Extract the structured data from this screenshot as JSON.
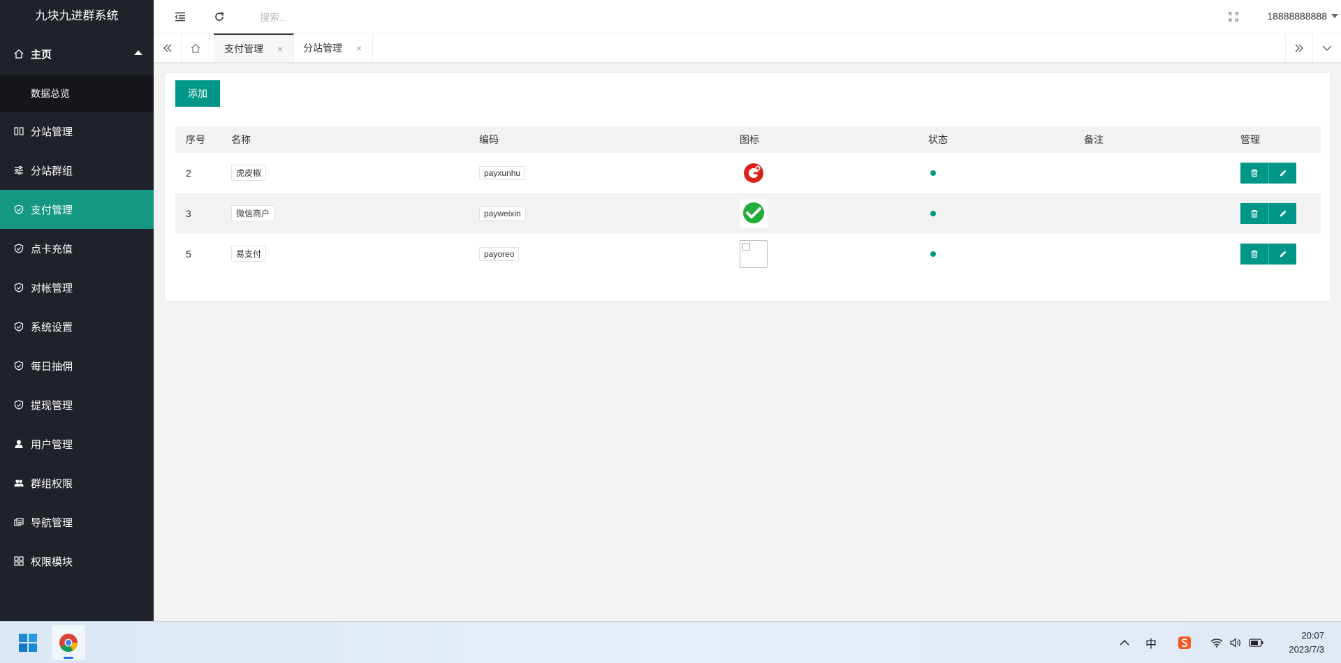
{
  "app": {
    "title": "九块九进群系统"
  },
  "sidebar": {
    "home": {
      "label": "主页"
    },
    "sub": {
      "label": "数据总览"
    },
    "items": [
      {
        "label": "分站管理",
        "icon": "columns-icon"
      },
      {
        "label": "分站群组",
        "icon": "sliders-icon"
      },
      {
        "label": "支付管理",
        "icon": "shield-check-icon",
        "active": true
      },
      {
        "label": "点卡充值",
        "icon": "shield-check-icon"
      },
      {
        "label": "对帐管理",
        "icon": "shield-check-icon"
      },
      {
        "label": "系统设置",
        "icon": "shield-check-icon"
      },
      {
        "label": "每日抽佣",
        "icon": "shield-check-icon"
      },
      {
        "label": "提现管理",
        "icon": "shield-check-icon"
      },
      {
        "label": "用户管理",
        "icon": "user-icon"
      },
      {
        "label": "群组权限",
        "icon": "users-icon"
      },
      {
        "label": "导航管理",
        "icon": "nav-icon"
      },
      {
        "label": "权限模块",
        "icon": "grid-icon"
      }
    ]
  },
  "header": {
    "search_placeholder": "搜索...",
    "user": "18888888888"
  },
  "tabs": [
    {
      "label": "支付管理",
      "active": true
    },
    {
      "label": "分站管理",
      "active": false
    }
  ],
  "main": {
    "add_label": "添加",
    "columns": [
      "序号",
      "名称",
      "编码",
      "图标",
      "状态",
      "备注",
      "管理"
    ],
    "rows": [
      {
        "id": "2",
        "name": "虎皮椒",
        "code": "payxunhu",
        "icon": "xunhu-logo",
        "status": "enabled",
        "remark": ""
      },
      {
        "id": "3",
        "name": "微信商户",
        "code": "payweixin",
        "icon": "wechat-logo",
        "status": "enabled",
        "remark": ""
      },
      {
        "id": "5",
        "name": "易支付",
        "code": "payoreo",
        "icon": "broken-image",
        "status": "enabled",
        "remark": ""
      }
    ]
  },
  "taskbar": {
    "time": "20:07",
    "date": "2023/7/3",
    "ime": "中"
  },
  "colors": {
    "sidebar_bg": "#20222a",
    "accent": "#009688",
    "active_nav": "#149884"
  }
}
